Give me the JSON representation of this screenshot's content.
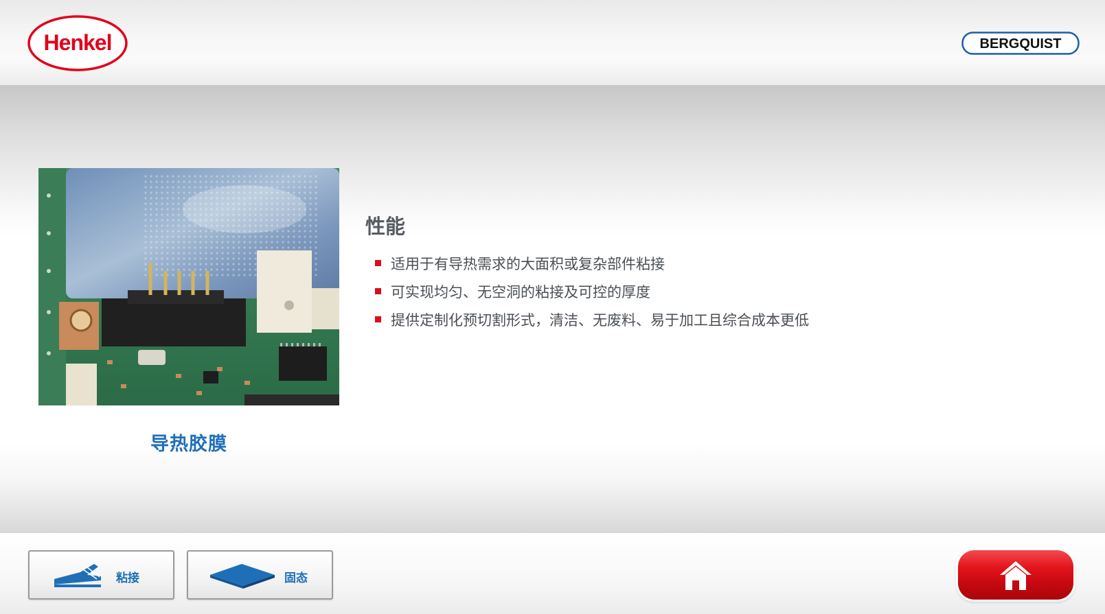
{
  "header": {
    "brand_logo_text": "Henkel",
    "partner_logo_text": "BERGQUIST"
  },
  "product": {
    "name": "导热胶膜",
    "image_icon": "circuit-board-photo"
  },
  "performance": {
    "title": "性能",
    "items": [
      "适用于有导热需求的大面积或复杂部件粘接",
      "可实现均匀、无空洞的粘接及可控的厚度",
      "提供定制化预切割形式，清洁、无废料、易于加工且综合成本更低"
    ]
  },
  "footer": {
    "buttons": [
      {
        "label": "粘接",
        "icon": "bonding-icon"
      },
      {
        "label": "固态",
        "icon": "solid-pad-icon"
      }
    ],
    "home_icon": "home-icon"
  },
  "colors": {
    "accent_blue": "#1f6fb8",
    "brand_red": "#d7101e",
    "text_gray": "#4a4f55"
  }
}
